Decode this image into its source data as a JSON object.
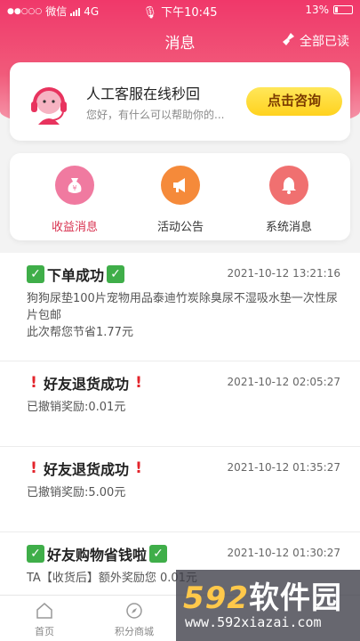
{
  "status_bar": {
    "carrier": "微信",
    "network": "4G",
    "time": "下午10:45",
    "battery": "13%"
  },
  "header": {
    "title": "消息",
    "read_all": "全部已读"
  },
  "customer_service": {
    "title": "人工客服在线秒回",
    "subtitle": "您好，有什么可以帮助你的...",
    "button": "点击咨询"
  },
  "categories": [
    {
      "label": "收益消息",
      "icon": "money-bag-icon",
      "color": "#f07aa0",
      "active": true
    },
    {
      "label": "活动公告",
      "icon": "megaphone-icon",
      "color": "#f58a3a",
      "active": false
    },
    {
      "label": "系统消息",
      "icon": "bell-icon",
      "color": "#f07070",
      "active": false
    }
  ],
  "messages": [
    {
      "title": "下单成功",
      "time": "2021-10-12 13:21:16",
      "decor": "check",
      "body1": "狗狗尿垫100片宠物用品泰迪竹炭除臭尿不湿吸水垫一次性尿片包邮",
      "body2": "此次帮您节省1.77元"
    },
    {
      "title": "好友退货成功",
      "time": "2021-10-12 02:05:27",
      "decor": "exclamation",
      "body1": "已撤销奖励:0.01元"
    },
    {
      "title": "好友退货成功",
      "time": "2021-10-12 01:35:27",
      "decor": "exclamation",
      "body1": "已撤销奖励:5.00元"
    },
    {
      "title": "好友购物省钱啦",
      "time": "2021-10-12 01:30:27",
      "decor": "check",
      "body1": "TA【收货后】额外奖励您 0.01元"
    }
  ],
  "tabbar": {
    "home": "首页",
    "mall": "积分商城"
  },
  "watermark": {
    "brand_num": "592",
    "brand_text": "软件园",
    "url": "www.592xiazai.com"
  }
}
